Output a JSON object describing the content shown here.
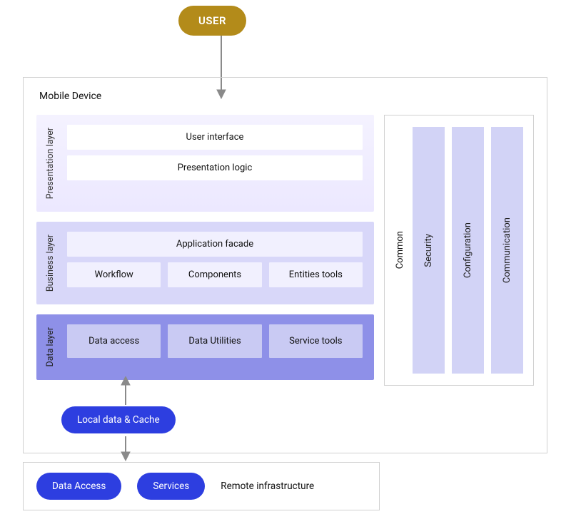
{
  "user_label": "USER",
  "device": {
    "title": "Mobile Device",
    "layers": {
      "presentation": {
        "label": "Presentation\nlayer",
        "rows": [
          [
            "User interface"
          ],
          [
            "Presentation logic"
          ]
        ]
      },
      "business": {
        "label": "Business\nlayer",
        "rows": [
          [
            "Application facade"
          ],
          [
            "Workflow",
            "Components",
            "Entities tools"
          ]
        ]
      },
      "data": {
        "label": "Data\nlayer",
        "rows": [
          [
            "Data access",
            "Data Utilities",
            "Service tools"
          ]
        ]
      }
    },
    "common": {
      "label": "Common",
      "columns": [
        "Security",
        "Configuration",
        "Communication"
      ]
    }
  },
  "local_cache_label": "Local data & Cache",
  "remote": {
    "pills": [
      "Data Access",
      "Services"
    ],
    "label": "Remote\ninfrastructure"
  }
}
